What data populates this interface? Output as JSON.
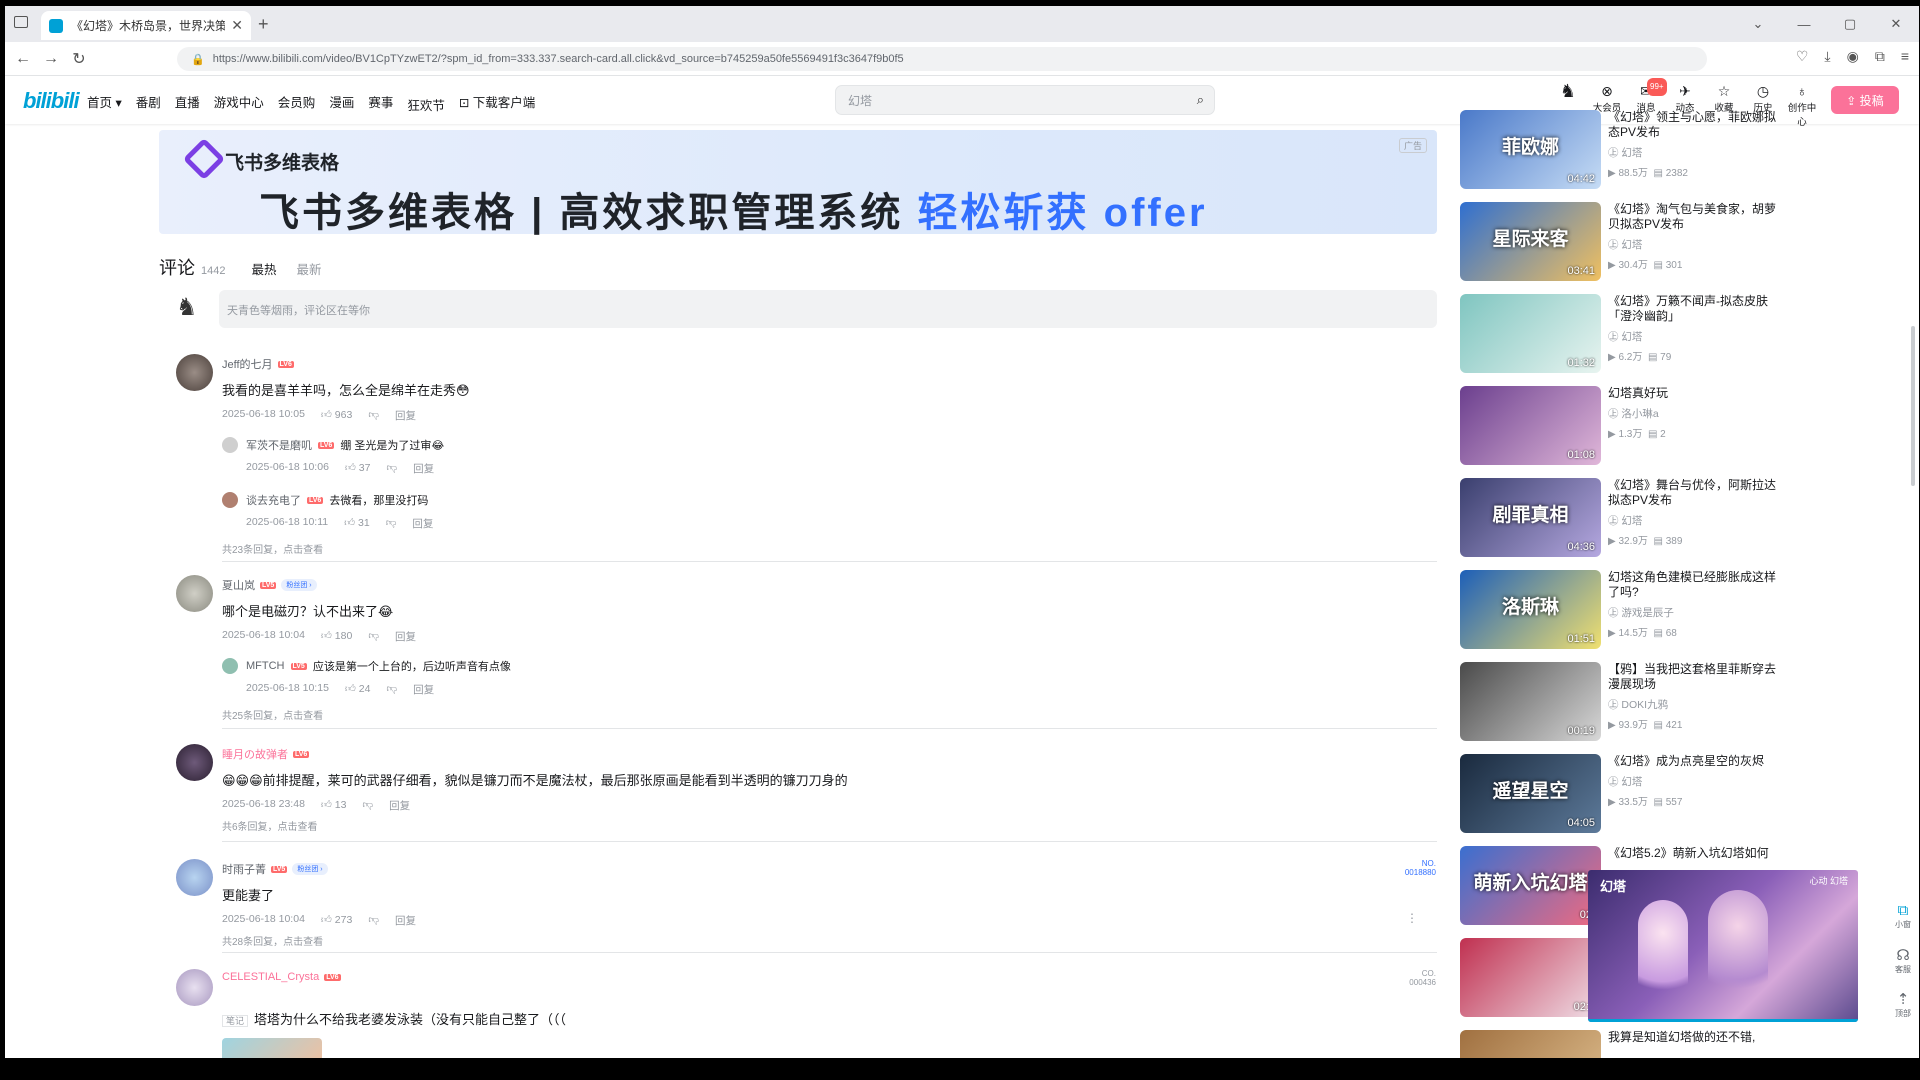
{
  "browser": {
    "tab_title": "《幻塔》木桥岛景，世界决策P...",
    "url": "https://www.bilibili.com/video/BV1CpTYzwET2/?spm_id_from=333.337.search-card.all.click&vd_source=b745259a50fe5569491f3c3647f9b0f5"
  },
  "header": {
    "logo": "bilibili",
    "nav": [
      "首页 ▾",
      "番剧",
      "直播",
      "游戏中心",
      "会员购",
      "漫画",
      "赛事",
      "狂欢节",
      "⊡ 下载客户端"
    ],
    "search_placeholder": "幻塔",
    "icons": [
      {
        "label": "大会员",
        "glyph": "⊗"
      },
      {
        "label": "消息",
        "glyph": "✉",
        "badge": "99+"
      },
      {
        "label": "动态",
        "glyph": "✈"
      },
      {
        "label": "收藏",
        "glyph": "☆"
      },
      {
        "label": "历史",
        "glyph": "◷"
      },
      {
        "label": "创作中心",
        "glyph": "♁"
      }
    ],
    "upload_label": "⇪ 投稿"
  },
  "ad": {
    "brand": "飞书多维表格",
    "slogan_main": "飞书多维表格 | 高效求职管理系统 ",
    "slogan_accent": "轻松斩获 offer",
    "tag": "广告"
  },
  "comments_header": {
    "title": "评论",
    "count": "1442",
    "sort_hot": "最热",
    "sort_new": "最新",
    "input_placeholder": "天青色等烟雨，评论区在等你"
  },
  "comments": [
    {
      "user": "Jeff的七月",
      "level": "LV6",
      "text": "我看的是喜羊羊吗，怎么全是绵羊在走秀😳",
      "time": "2025-06-18 10:05",
      "likes": "963",
      "reply_label": "回复",
      "replies": [
        {
          "user": "军茨不是磨叽",
          "level": "LV6",
          "text": "绷 圣光是为了过审😂",
          "time": "2025-06-18 10:06",
          "likes": "37",
          "reply_label": "回复"
        },
        {
          "user": "谈去充电了",
          "level": "LV6",
          "text": "去微看，那里没打码",
          "time": "2025-06-18 10:11",
          "likes": "31",
          "reply_label": "回复"
        }
      ],
      "more": "共23条回复，点击查看"
    },
    {
      "user": "夏山岚",
      "level": "LV5",
      "fan": "粉丝团 ›",
      "text": "哪个是电磁刃？认不出来了😂",
      "time": "2025-06-18 10:04",
      "likes": "180",
      "reply_label": "回复",
      "replies": [
        {
          "user": "MFTCH",
          "level": "LV5",
          "text": "应该是第一个上台的，后边听声音有点像",
          "time": "2025-06-18 10:15",
          "likes": "24",
          "reply_label": "回复"
        }
      ],
      "more": "共25条回复，点击查看"
    },
    {
      "user": "睡月の故弹者",
      "level": "LV6",
      "text": "😁😁😁前排提醒，莱可的武器仔细看，貌似是镰刀而不是魔法杖，最后那张原画是能看到半透明的镰刀刀身的",
      "time": "2025-06-18 23:48",
      "likes": "13",
      "reply_label": "回复",
      "replies": [],
      "more": "共6条回复，点击查看"
    },
    {
      "user": "时雨子菁",
      "level": "LV5",
      "fan": "粉丝团 ›",
      "text": "更能妻了",
      "time": "2025-06-18 10:04",
      "likes": "273",
      "reply_label": "回复",
      "replies": [],
      "more": "共28条回复，点击查看",
      "deco": "NO.\n0018880"
    },
    {
      "user": "CELESTIAL_Crysta",
      "level": "LV6",
      "text": "塔塔为什么不给我老婆发泳装（没有只能自己整了（（（",
      "note_label": "笔记",
      "deco": "CO.\n000436"
    }
  ],
  "related": [
    {
      "title": "《幻塔》领主与心愿，菲欧娜拟态PV发布",
      "up": "幻塔",
      "views": "88.5万",
      "danmaku": "2382",
      "duration": "04:42",
      "overlay": "菲欧娜",
      "color1": "#4a79c9",
      "color2": "#c6dcf5"
    },
    {
      "title": "《幻塔》淘气包与美食家，胡萝贝拟态PV发布",
      "up": "幻塔",
      "views": "30.4万",
      "danmaku": "301",
      "duration": "03:41",
      "overlay": "星际来客",
      "color1": "#2f6fd0",
      "color2": "#f0c060"
    },
    {
      "title": "《幻塔》万籁不闻声-拟态皮肤「澄泠幽韵」",
      "up": "幻塔",
      "views": "6.2万",
      "danmaku": "79",
      "duration": "01:32",
      "overlay": "",
      "color1": "#7fc5c0",
      "color2": "#e8f4f0"
    },
    {
      "title": "幻塔真好玩",
      "up": "洛小琳a",
      "views": "1.3万",
      "danmaku": "2",
      "duration": "01:08",
      "overlay": "",
      "color1": "#6b3f8e",
      "color2": "#e0b7d9"
    },
    {
      "title": "《幻塔》舞台与优伶，阿斯拉达拟态PV发布",
      "up": "幻塔",
      "views": "32.9万",
      "danmaku": "389",
      "duration": "04:36",
      "overlay": "剧罪真相",
      "color1": "#3a3f6e",
      "color2": "#b5a8e0"
    },
    {
      "title": "幻塔这角色建模已经膨胀成这样了吗?",
      "up": "游戏是辰子",
      "views": "14.5万",
      "danmaku": "68",
      "duration": "01:51",
      "overlay": "洛斯琳",
      "color1": "#1d5fb8",
      "color2": "#f0e070"
    },
    {
      "title": "【鸦】当我把这套格里菲斯穿去漫展现场",
      "up": "DOKI九鸦",
      "views": "93.9万",
      "danmaku": "421",
      "duration": "00:19",
      "overlay": "",
      "color1": "#4a4a4a",
      "color2": "#d8d8d8"
    },
    {
      "title": "《幻塔》成为点亮星空的灰烬",
      "up": "幻塔",
      "views": "33.5万",
      "danmaku": "557",
      "duration": "04:05",
      "overlay": "遥望星空",
      "color1": "#1a2a3e",
      "color2": "#5d7a9a"
    },
    {
      "title": "《幻塔5.2》萌新入坑幻塔如何",
      "up": "",
      "views": "",
      "danmaku": "",
      "duration": "02:",
      "overlay": "萌新入坑幻塔",
      "color1": "#3a6fd0",
      "color2": "#f06a80"
    },
    {
      "title": "",
      "up": "",
      "views": "",
      "danmaku": "",
      "duration": "02:0",
      "overlay": "",
      "color1": "#c03050",
      "color2": "#f0e0e8"
    },
    {
      "title": "我算是知道幻塔做的还不错,",
      "up": "",
      "views": "",
      "danmaku": "",
      "duration": "",
      "overlay": "",
      "color1": "#a07040",
      "color2": "#e0c090"
    }
  ],
  "miniplayer": {
    "logo": "幻塔",
    "corner": "心动 幻塔"
  },
  "fixed_right": [
    {
      "label": "小窗",
      "glyph": "⧉"
    },
    {
      "label": "客服",
      "glyph": "☊"
    },
    {
      "label": "顶部",
      "glyph": "⇡"
    }
  ]
}
